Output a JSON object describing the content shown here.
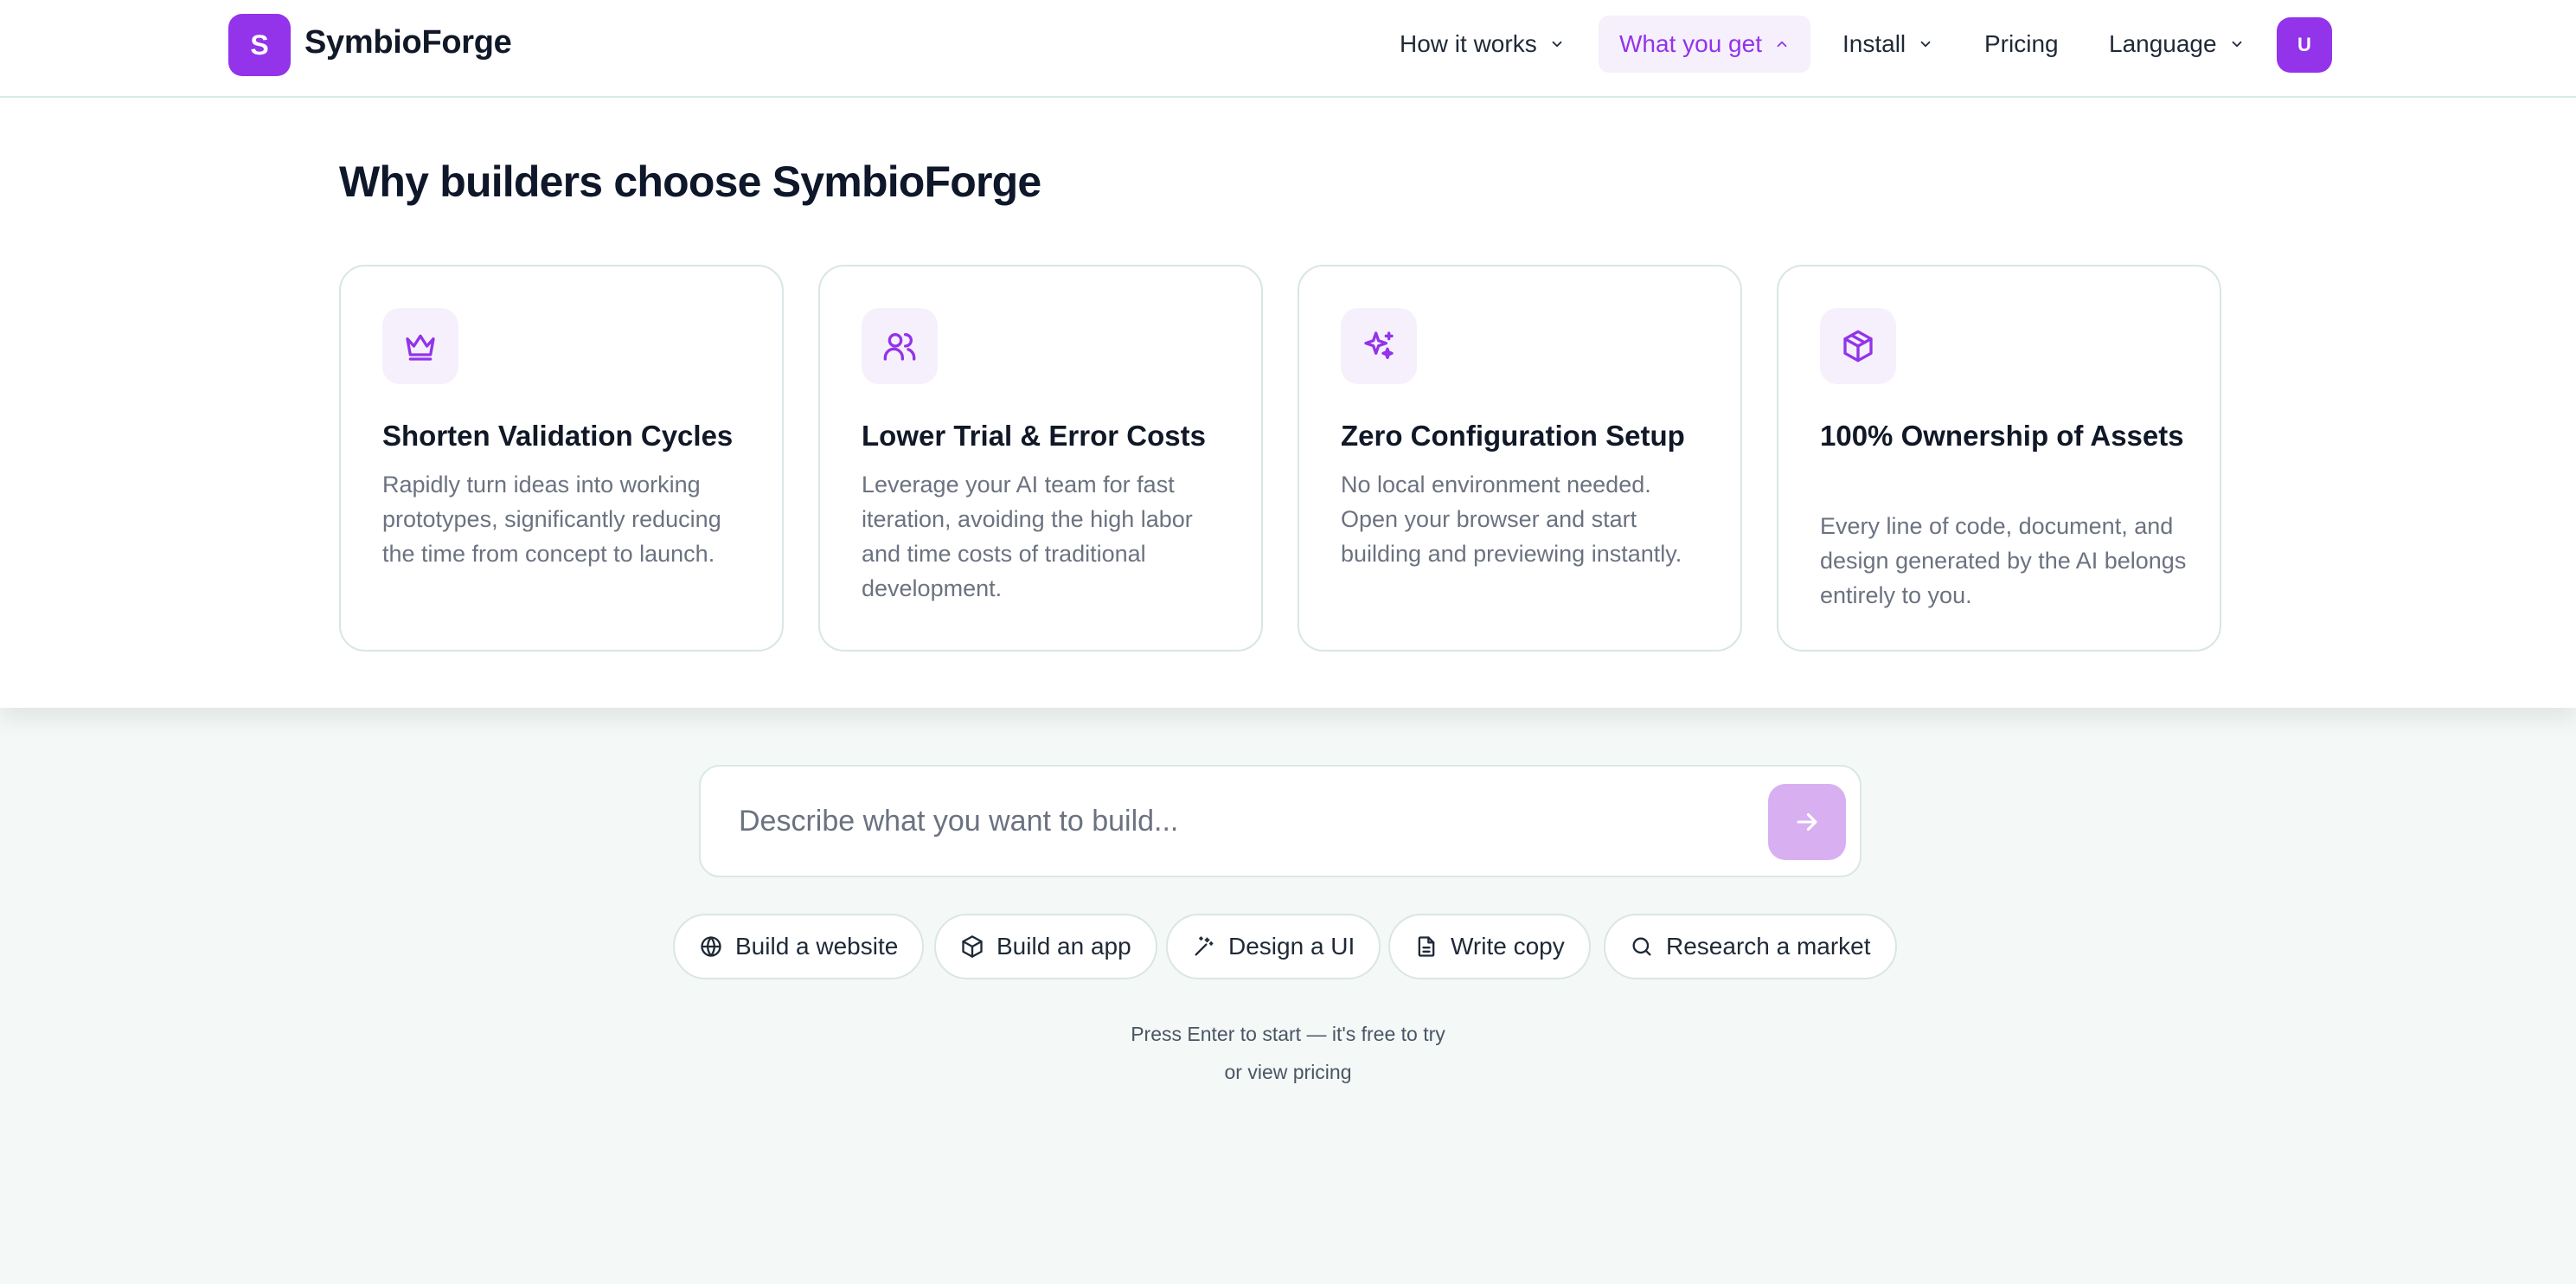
{
  "brand": {
    "logo_letter": "S",
    "name": "SymbioForge",
    "accent": "#9333ea"
  },
  "nav": {
    "items": [
      {
        "label": "How it works"
      },
      {
        "label": "What you get"
      },
      {
        "label": "Install"
      },
      {
        "label": "Pricing"
      },
      {
        "label": "Language"
      }
    ],
    "avatar_letter": "U"
  },
  "panel": {
    "title": "Why builders choose SymbioForge",
    "cards": [
      {
        "icon": "crown-icon",
        "title": "Shorten Validation Cycles",
        "desc": "Rapidly turn ideas into working prototypes, significantly reducing the time from concept to launch."
      },
      {
        "icon": "users-icon",
        "title": "Lower Trial & Error Costs",
        "desc": "Leverage your AI team for fast iteration, avoiding the high labor and time costs of traditional development."
      },
      {
        "icon": "sparkles-icon",
        "title": "Zero Configuration Setup",
        "desc": "No local environment needed. Open your browser and start building and previewing instantly."
      },
      {
        "icon": "box-icon",
        "title": "100% Ownership of Assets",
        "desc": "Every line of code, document, and design generated by the AI belongs entirely to you."
      }
    ]
  },
  "composer": {
    "placeholder": "Describe what you want to build...",
    "send_icon": "arrow-right-icon"
  },
  "chips": [
    {
      "icon": "globe-icon",
      "label": "Build a website"
    },
    {
      "icon": "box-icon",
      "label": "Build an app"
    },
    {
      "icon": "wand-icon",
      "label": "Design a UI"
    },
    {
      "icon": "document-icon",
      "label": "Write copy"
    },
    {
      "icon": "search-icon",
      "label": "Research a market"
    }
  ],
  "hint": {
    "line1": "Press Enter to start — it's free to try",
    "line2": "or view pricing"
  }
}
